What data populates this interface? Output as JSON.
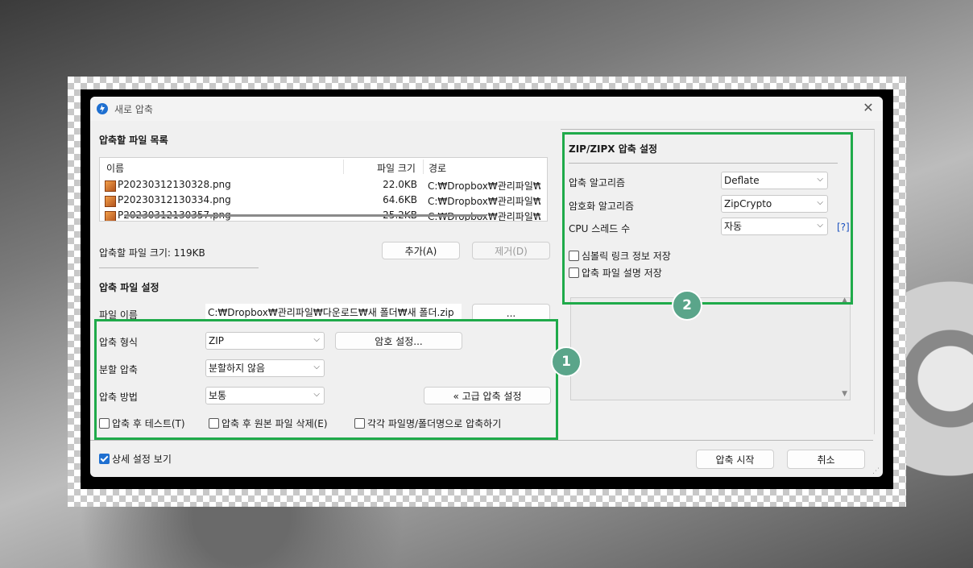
{
  "dialog": {
    "title": "새로 압축",
    "close_glyph": "✕"
  },
  "file_list": {
    "section_title": "압축할 파일 목록",
    "columns": {
      "name": "이름",
      "size": "파일 크기",
      "path": "경로"
    },
    "rows": [
      {
        "name": "P20230312130328.png",
        "size": "22.0KB",
        "path": "C:₩Dropbox₩관리파일₩"
      },
      {
        "name": "P20230312130334.png",
        "size": "64.6KB",
        "path": "C:₩Dropbox₩관리파일₩"
      },
      {
        "name": "P20230312130357.png",
        "size": "25.2KB",
        "path": "C:₩Dropbox₩관리파일₩"
      }
    ],
    "total_size_label": "압축할 파일 크기: 119KB",
    "add_button": "추가(A)",
    "remove_button": "제거(D)"
  },
  "settings": {
    "section_title": "압축 파일 설정",
    "filename_label": "파일 이름",
    "filename_value": "C:₩Dropbox₩관리파일₩다운로드₩새 폴더₩새 폴더.zip",
    "browse_button": "...",
    "format_label": "압축 형식",
    "format_value": "ZIP",
    "password_button": "암호 설정...",
    "split_label": "분할 압축",
    "split_value": "분할하지 않음",
    "method_label": "압축 방법",
    "method_value": "보통",
    "advanced_button": "« 고급 압축 설정",
    "test_after": "압축 후 테스트(T)",
    "delete_after": "압축 후 원본 파일 삭제(E)",
    "each_file": "각각 파일명/폴더명으로 압축하기"
  },
  "zip_settings": {
    "section_title": "ZIP/ZIPX 압축 설정",
    "algorithm_label": "압축 알고리즘",
    "algorithm_value": "Deflate",
    "encryption_label": "암호화 알고리즘",
    "encryption_value": "ZipCrypto",
    "threads_label": "CPU 스레드 수",
    "threads_value": "자동",
    "help_link": "[?]",
    "symlink_option": "심볼릭 링크 정보 저장",
    "comment_option": "압축 파일 설명 저장"
  },
  "footer": {
    "show_details": "상세 설정 보기",
    "show_details_checked": true,
    "start_button": "압축 시작",
    "cancel_button": "취소"
  },
  "annotations": {
    "badge1": "1",
    "badge2": "2",
    "highlight_color": "#1faa4a",
    "badge_color": "#5aa58a"
  },
  "colors": {
    "accent": "#1e6fd0",
    "dialog_bg": "#f0f0f0"
  }
}
